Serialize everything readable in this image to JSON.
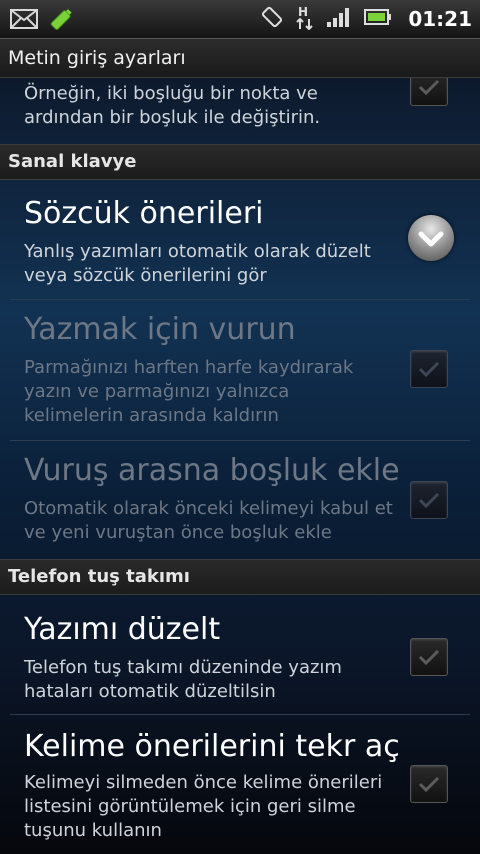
{
  "status_bar": {
    "time": "01:21",
    "left_icons": [
      "email-icon",
      "battery-charging-icon"
    ],
    "right_icons": [
      "rotation-icon",
      "data-transfer-icon",
      "signal-icon",
      "battery-icon"
    ],
    "data_label": "H"
  },
  "title_bar": {
    "title": "Metin giriş ayarları"
  },
  "items": {
    "partial": {
      "summary": "Örneğin, iki boşluğu bir nokta ve ardından bir boşluk ile değiştirin."
    },
    "category_1": "Sanal klavye",
    "word_suggestions": {
      "title": "Sözcük önerileri",
      "summary": "Yanlış yazımları otomatik olarak düzelt veya sözcük önerilerini gör"
    },
    "tap_to_type": {
      "title": "Yazmak için vurun",
      "summary": "Parmağınızı harften harfe kaydırarak yazın ve parmağınızı yalnızca kelimelerin arasında kaldırın"
    },
    "space_between": {
      "title": "Vuruş arasna boşluk ekle",
      "summary": "Otomatik olarak önceki kelimeyi kabul et ve yeni vuruştan önce boşluk ekle"
    },
    "category_2": "Telefon tuş takımı",
    "auto_correct": {
      "title": "Yazımı düzelt",
      "summary": "Telefon tuş takımı düzeninde yazım hataları otomatik düzeltilsin"
    },
    "reopen_suggestions": {
      "title": "Kelime önerilerini tekr aç",
      "summary": "Kelimeyi silmeden önce kelime önerileri listesini görüntülemek için geri silme tuşunu kullanın"
    }
  },
  "colors": {
    "accent_blue": "#123253",
    "disabled_text": "#6d7785",
    "battery_green": "#7ad13a"
  }
}
